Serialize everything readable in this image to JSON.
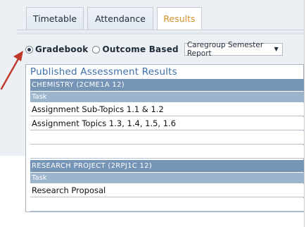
{
  "tabs": [
    {
      "label": "Timetable"
    },
    {
      "label": "Attendance"
    },
    {
      "label": "Results",
      "active": true
    }
  ],
  "view_options": {
    "gradebook_label": "Gradebook",
    "outcome_label": "Outcome Based",
    "selected": "Gradebook",
    "report_select_value": "Caregroup Semester Report"
  },
  "published": {
    "title": "Published Assessment Results",
    "sections": [
      {
        "subject": "CHEMISTRY (2CME1A 12)",
        "task_header": "Task",
        "tasks": [
          "Assignment Sub-Topics 1.1 & 1.2",
          "Assignment Topics 1.3, 1.4, 1.5, 1.6"
        ]
      },
      {
        "subject": "RESEARCH PROJECT (2RPJ1C 12)",
        "task_header": "Task",
        "tasks": [
          "Research Proposal"
        ]
      }
    ]
  },
  "colors": {
    "accent_tab": "#d6912a",
    "header_blue": "#7594b6",
    "task_header_blue": "#9cb4cc",
    "title_blue": "#3d6fa8",
    "arrow_red": "#c0392b"
  }
}
